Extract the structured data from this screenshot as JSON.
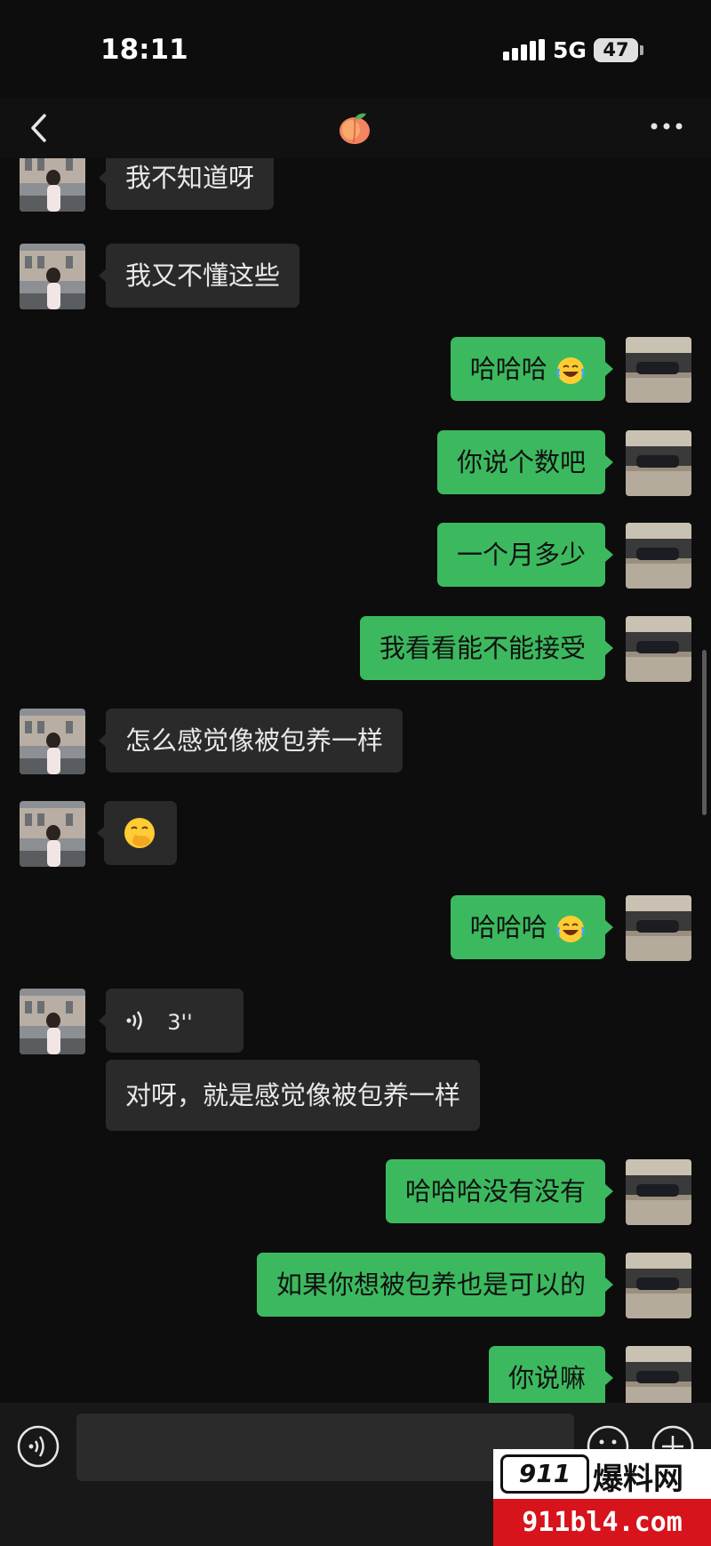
{
  "status_bar": {
    "time": "18:11",
    "network": "5G",
    "battery": "47"
  },
  "nav": {
    "title_icon": "peach-emoji-icon",
    "back_icon": "chevron-left-icon",
    "more_icon": "more-dots-icon"
  },
  "messages": [
    {
      "side": "in",
      "text": "我不知道呀"
    },
    {
      "side": "in",
      "text": "我又不懂这些"
    },
    {
      "side": "out",
      "text": "哈哈哈",
      "emoji": "laughing-tears-emoji"
    },
    {
      "side": "out",
      "text": "你说个数吧"
    },
    {
      "side": "out",
      "text": "一个月多少"
    },
    {
      "side": "out",
      "text": "我看看能不能接受"
    },
    {
      "side": "in",
      "text": "怎么感觉像被包养一样"
    },
    {
      "side": "in",
      "text": "",
      "emoji": "thinking-hand-over-mouth-emoji"
    },
    {
      "side": "out",
      "text": "哈哈哈",
      "emoji": "laughing-tears-emoji"
    },
    {
      "side": "in",
      "type": "voice",
      "duration": "3''"
    },
    {
      "side": "in",
      "text": "对呀，就是感觉像被包养一样"
    },
    {
      "side": "out",
      "text": "哈哈哈没有没有"
    },
    {
      "side": "out",
      "text": "如果你想被包养也是可以的"
    },
    {
      "side": "out",
      "text": "你说嘛"
    }
  ],
  "input_bar": {
    "placeholder": "",
    "voice_icon": "voice-input-icon",
    "emoji_icon": "emoji-face-icon",
    "plus_icon": "plus-icon"
  },
  "watermark": {
    "logo": "911",
    "name": "爆料网",
    "url": "911bl4.com"
  },
  "colors": {
    "incoming_bubble": "#2a2a2a",
    "outgoing_bubble": "#3cb95e",
    "background": "#0d0d0d"
  }
}
